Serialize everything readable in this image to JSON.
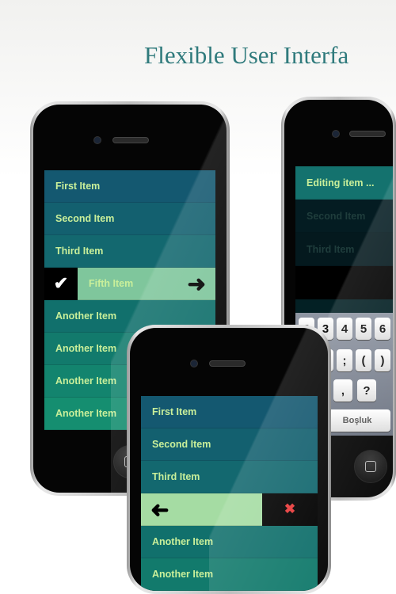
{
  "title": "Flexible User Interfa",
  "colors": {
    "accent": "#2f7a7c",
    "row_text": "#c9ef9a",
    "swipe": "#a5dca3",
    "delete": "#e83a3a"
  },
  "left_phone": {
    "rows": [
      "First Item",
      "Second Item",
      "Third Item",
      "Another Item",
      "Another Item",
      "Another Item",
      "Another Item"
    ],
    "swipe_item": "Fifth Item",
    "swipe_icons": [
      "checkmark-icon",
      "arrow-right-icon"
    ]
  },
  "right_phone": {
    "editing": "Editing item ...",
    "rows": [
      "Second Item",
      "Third Item"
    ],
    "keyboard": {
      "row1": [
        "2",
        "3",
        "4",
        "5",
        "6"
      ],
      "row2": [
        ":",
        ";",
        "(",
        ")"
      ],
      "row3": [
        ".",
        ",",
        "?"
      ],
      "space": "Boşluk"
    }
  },
  "front_phone": {
    "rows": [
      "First Item",
      "Second Item",
      "Third Item",
      "Another Item",
      "Another Item"
    ],
    "swipe_icons": [
      "arrow-left-icon",
      "delete-x-icon"
    ],
    "delete_glyph": "✖"
  }
}
